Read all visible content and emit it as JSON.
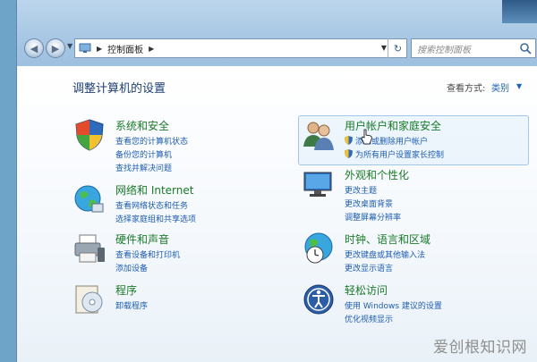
{
  "address_bar": {
    "breadcrumb": "控制面板"
  },
  "search": {
    "placeholder": "搜索控制面板"
  },
  "page_title": "调整计算机的设置",
  "view_by": {
    "label": "查看方式:",
    "value": "类别"
  },
  "categories": [
    {
      "title": "系统和安全",
      "links": [
        "查看您的计算机状态",
        "备份您的计算机",
        "查找并解决问题"
      ]
    },
    {
      "title": "网络和 Internet",
      "links": [
        "查看网络状态和任务",
        "选择家庭组和共享选项"
      ]
    },
    {
      "title": "硬件和声音",
      "links": [
        "查看设备和打印机",
        "添加设备"
      ]
    },
    {
      "title": "程序",
      "links": [
        "卸载程序"
      ]
    },
    {
      "title": "用户帐户和家庭安全",
      "links": [
        "添加或删除用户帐户",
        "为所有用户设置家长控制"
      ]
    },
    {
      "title": "外观和个性化",
      "links": [
        "更改主题",
        "更改桌面背景",
        "调整屏幕分辨率"
      ]
    },
    {
      "title": "时钟、语言和区域",
      "links": [
        "更改键盘或其他输入法",
        "更改显示语言"
      ]
    },
    {
      "title": "轻松访问",
      "links": [
        "使用 Windows 建议的设置",
        "优化视频显示"
      ]
    }
  ],
  "watermark": "爱创根知识网",
  "colors": {
    "title_green": "#1a7a2a",
    "link_blue": "#1e5db0",
    "heading_blue": "#1e3f74"
  }
}
